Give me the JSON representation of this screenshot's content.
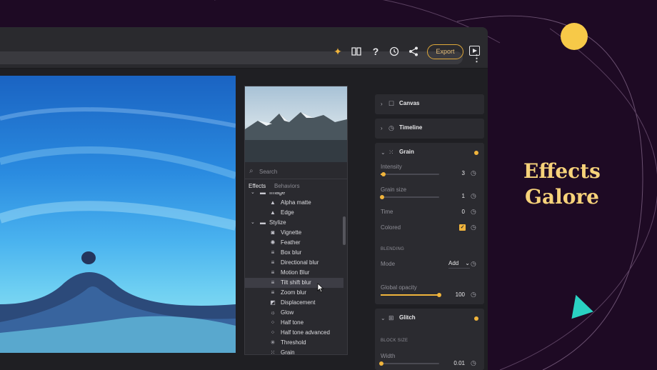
{
  "hero": {
    "title_line1": "Effects",
    "title_line2": "Galore"
  },
  "colors": {
    "accent": "#f0b43c",
    "export_border": "#e0a93a",
    "background": "#1e0a24",
    "sun": "#f7c948",
    "triangle": "#2ad1c2"
  },
  "toolbar": {
    "icons": [
      "sparkle-icon",
      "book-icon",
      "help-icon",
      "history-icon",
      "share-icon"
    ],
    "export_label": "Export"
  },
  "effects_panel": {
    "search_placeholder": "Search",
    "tabs": [
      "Effects",
      "Behaviors"
    ],
    "items": [
      {
        "label": "Image",
        "type": "folder"
      },
      {
        "label": "Alpha matte",
        "icon": "mountain-icon"
      },
      {
        "label": "Edge",
        "icon": "mountain-icon"
      },
      {
        "label": "Stylize",
        "type": "folder"
      },
      {
        "label": "Vignette",
        "icon": "vignette-icon"
      },
      {
        "label": "Feather",
        "icon": "feather-icon"
      },
      {
        "label": "Box blur",
        "icon": "blur-icon"
      },
      {
        "label": "Directional blur",
        "icon": "blur-icon"
      },
      {
        "label": "Motion Blur",
        "icon": "blur-icon"
      },
      {
        "label": "Tilt shift blur",
        "icon": "blur-icon",
        "highlighted": true
      },
      {
        "label": "Zoom blur",
        "icon": "blur-icon"
      },
      {
        "label": "Displacement",
        "icon": "displacement-icon"
      },
      {
        "label": "Glow",
        "icon": "glow-icon"
      },
      {
        "label": "Half tone",
        "icon": "halftone-icon"
      },
      {
        "label": "Half tone advanced",
        "icon": "halftone-icon"
      },
      {
        "label": "Threshold",
        "icon": "threshold-icon"
      },
      {
        "label": "Grain",
        "icon": "grain-icon"
      }
    ]
  },
  "properties": {
    "canvas": {
      "label": "Canvas"
    },
    "timeline": {
      "label": "Timeline"
    },
    "grain": {
      "label": "Grain",
      "intensity": {
        "label": "Intensity",
        "value": "3",
        "level": 0.05
      },
      "grain_size": {
        "label": "Grain size",
        "value": "1",
        "level": 0.03
      },
      "time": {
        "label": "Time",
        "value": "0"
      },
      "colored": {
        "label": "Colored",
        "checked": true
      },
      "blending_header": "BLENDING",
      "mode": {
        "label": "Mode",
        "value": "Add"
      },
      "global_opacity": {
        "label": "Global opacity",
        "value": "100",
        "level": 1.0
      }
    },
    "glitch": {
      "label": "Glitch",
      "block_size_header": "BLOCK SIZE",
      "width": {
        "label": "Width",
        "value": "0.01",
        "level": 0.01
      }
    }
  }
}
